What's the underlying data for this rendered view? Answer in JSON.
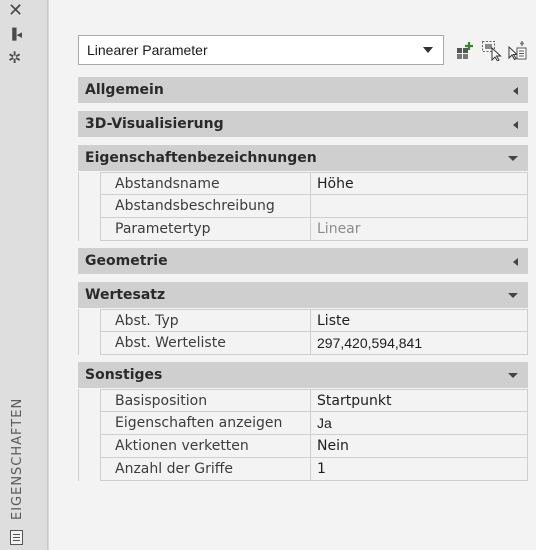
{
  "palette": {
    "title": "EIGENSCHAFTEN",
    "icons": [
      "close-icon",
      "pin-icon",
      "settings-icon",
      "properties-icon"
    ]
  },
  "toolbar": {
    "selection": "Linearer Parameter",
    "buttons": [
      "quick-select-icon",
      "select-objects-icon",
      "toggle-pickadd-icon"
    ]
  },
  "categories": [
    {
      "label": "Allgemein",
      "state": "collapsed",
      "rows": []
    },
    {
      "label": "3D-Visualisierung",
      "state": "collapsed",
      "rows": []
    },
    {
      "label": "Eigenschaftenbezeichnungen",
      "state": "expanded",
      "rows": [
        {
          "name": "Abstandsname",
          "value": "Höhe"
        },
        {
          "name": "Abstandsbeschreibung",
          "value": ""
        },
        {
          "name": "Parametertyp",
          "value": "Linear"
        }
      ]
    },
    {
      "label": "Geometrie",
      "state": "collapsed",
      "rows": []
    },
    {
      "label": "Wertesatz",
      "state": "expanded",
      "rows": [
        {
          "name": "Abst. Typ",
          "value": "Liste"
        },
        {
          "name": "Abst. Werteliste",
          "value": "297,420,594,841"
        }
      ]
    },
    {
      "label": "Sonstiges",
      "state": "expanded",
      "rows": [
        {
          "name": "Basisposition",
          "value": "Startpunkt"
        },
        {
          "name": "Eigenschaften anzeigen",
          "value": "Ja"
        },
        {
          "name": "Aktionen verketten",
          "value": "Nein"
        },
        {
          "name": "Anzahl der Griffe",
          "value": "1"
        }
      ]
    }
  ]
}
